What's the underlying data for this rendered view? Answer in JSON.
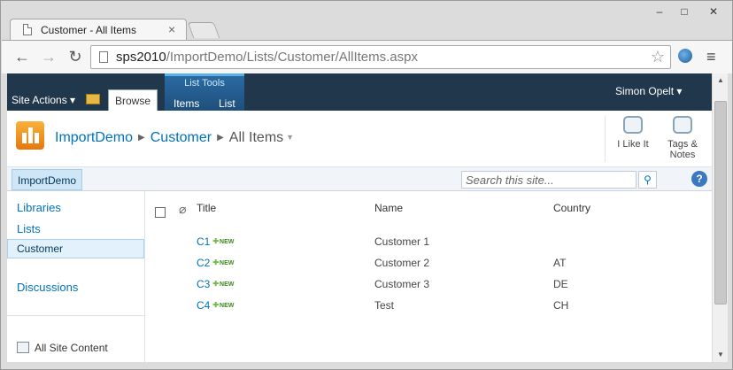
{
  "browser": {
    "tab_title": "Customer - All Items",
    "url_host": "sps2010",
    "url_path": "/ImportDemo/Lists/Customer/AllItems.aspx"
  },
  "ribbon": {
    "site_actions": "Site Actions ▾",
    "browse_tab": "Browse",
    "context_group_label": "List Tools",
    "items_tab": "Items",
    "list_tab": "List",
    "user_menu": "Simon Opelt ▾"
  },
  "breadcrumb": {
    "site": "ImportDemo",
    "list": "Customer",
    "view": "All Items"
  },
  "social": {
    "like_label": "I Like It",
    "tags_line1": "Tags &",
    "tags_line2": "Notes"
  },
  "topnav": {
    "site_link": "ImportDemo",
    "search_placeholder": "Search this site..."
  },
  "leftnav": {
    "libraries": "Libraries",
    "lists": "Lists",
    "selected": "Customer",
    "discussions": "Discussions",
    "all_site_content": "All Site Content"
  },
  "table": {
    "headers": {
      "title": "Title",
      "name": "Name",
      "country": "Country"
    },
    "new_badge": "NEW",
    "rows": [
      {
        "title": "C1",
        "name": "Customer 1",
        "country": ""
      },
      {
        "title": "C2",
        "name": "Customer 2",
        "country": "AT"
      },
      {
        "title": "C3",
        "name": "Customer 3",
        "country": "DE"
      },
      {
        "title": "C4",
        "name": "Test",
        "country": "CH"
      }
    ]
  },
  "colors": {
    "ribbon_bg": "#21374c",
    "link_blue": "#0072bc",
    "context_tab": "#2a6aa2"
  }
}
